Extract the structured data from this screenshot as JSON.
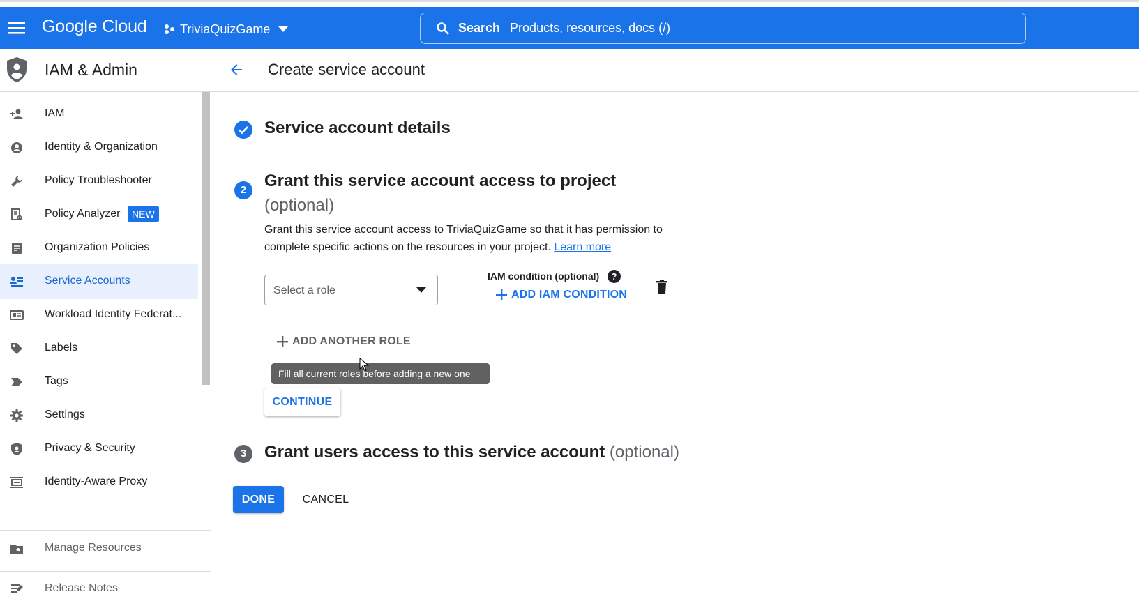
{
  "header": {
    "logo": "Google Cloud",
    "project": "TriviaQuizGame",
    "search_label": "Search",
    "search_placeholder": "Products, resources, docs (/)",
    "brand_color": "#1a73e8"
  },
  "sidebar": {
    "title": "IAM & Admin",
    "items": [
      {
        "label": "IAM",
        "icon": "person-add-icon"
      },
      {
        "label": "Identity & Organization",
        "icon": "account-circle-icon"
      },
      {
        "label": "Policy Troubleshooter",
        "icon": "wrench-icon"
      },
      {
        "label": "Policy Analyzer",
        "icon": "document-search-icon",
        "badge": "NEW"
      },
      {
        "label": "Organization Policies",
        "icon": "list-document-icon"
      },
      {
        "label": "Service Accounts",
        "icon": "service-account-icon",
        "active": true
      },
      {
        "label": "Workload Identity Federat...",
        "icon": "id-card-icon"
      },
      {
        "label": "Labels",
        "icon": "label-tag-icon"
      },
      {
        "label": "Tags",
        "icon": "tag-arrow-icon"
      },
      {
        "label": "Settings",
        "icon": "gear-icon"
      },
      {
        "label": "Privacy & Security",
        "icon": "shield-icon"
      },
      {
        "label": "Identity-Aware Proxy",
        "icon": "proxy-icon"
      }
    ],
    "bottom_items": [
      {
        "label": "Manage Resources",
        "icon": "folder-settings-icon"
      },
      {
        "label": "Release Notes",
        "icon": "notes-icon"
      }
    ]
  },
  "page": {
    "title": "Create service account"
  },
  "steps": {
    "step1": {
      "title": "Service account details"
    },
    "step2": {
      "number": "2",
      "title": "Grant this service account access to project",
      "optional": "(optional)",
      "description": "Grant this service account access to TriviaQuizGame so that it has permission to complete specific actions on the resources in your project.",
      "learn_more": "Learn more",
      "role_placeholder": "Select a role",
      "iam_condition_label": "IAM condition (optional)",
      "add_iam_condition": "ADD IAM CONDITION",
      "add_another_role": "ADD ANOTHER ROLE",
      "tooltip": "Fill all current roles before adding a new one",
      "continue": "CONTINUE"
    },
    "step3": {
      "number": "3",
      "title": "Grant users access to this service account",
      "optional": "(optional)"
    }
  },
  "actions": {
    "done": "DONE",
    "cancel": "CANCEL"
  }
}
